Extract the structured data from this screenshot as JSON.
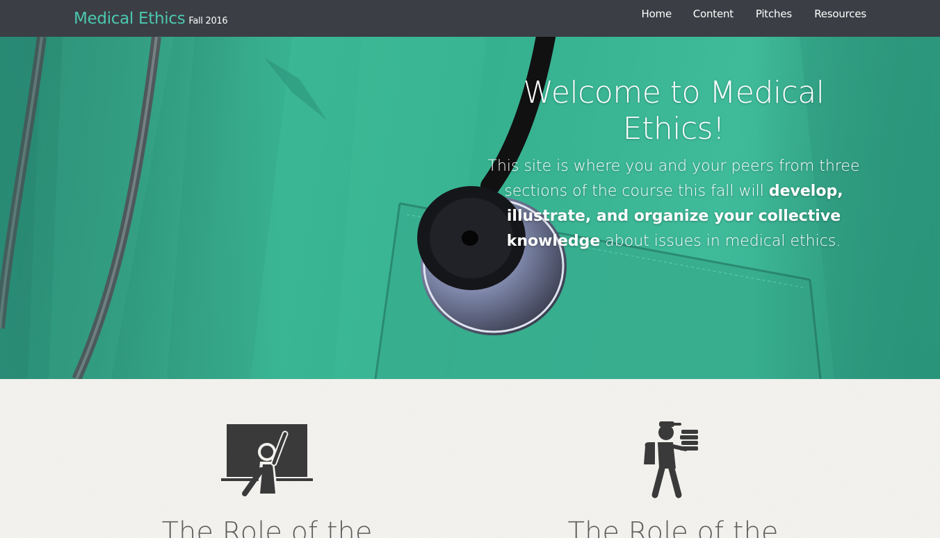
{
  "navbar": {
    "brand": "Medical Ethics",
    "brand_sub": "Fall 2016",
    "items": [
      {
        "label": "Home"
      },
      {
        "label": "Content"
      },
      {
        "label": "Pitches"
      },
      {
        "label": "Resources"
      }
    ]
  },
  "hero": {
    "title": "Welcome to Medical Ethics!",
    "lead_plain_1": "This site is where you and your peers from three sections of the course this fall will ",
    "lead_strong": "develop, illustrate, and organize your collective knowledge",
    "lead_plain_2": " about issues in medical ethics."
  },
  "features": [
    {
      "icon": "teacher-at-board-icon",
      "title": "The Role of the"
    },
    {
      "icon": "student-with-books-icon",
      "title": "The Role of the"
    }
  ],
  "colors": {
    "navbar_bg": "#3b3f45",
    "brand": "#4cc7b0",
    "scrubs": "#3cb896",
    "icon": "#3a3a3a"
  }
}
